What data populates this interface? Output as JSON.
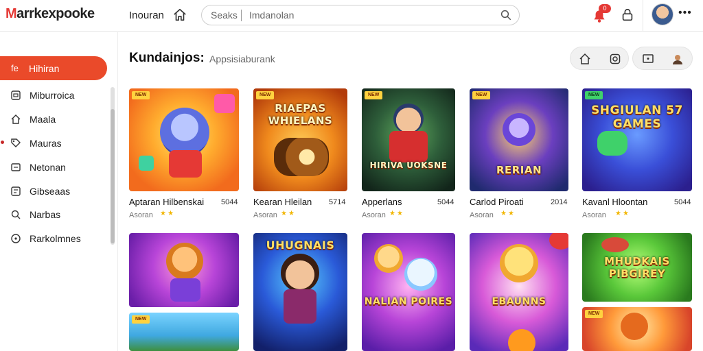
{
  "app": {
    "logo_initial": "M",
    "logo_rest": "arrkexpooke",
    "nav_label": "Inouran"
  },
  "search": {
    "label": "Seaks",
    "placeholder": "Imdanolan"
  },
  "notifications": {
    "badge": "0"
  },
  "sidebar": {
    "active": {
      "icon": "fe",
      "label": "Hihiran"
    },
    "items": [
      {
        "label": "Miburroica",
        "icon": "square-icon"
      },
      {
        "label": "Maala",
        "icon": "home-icon"
      },
      {
        "label": "Mauras",
        "icon": "tag-icon"
      },
      {
        "label": "Netonan",
        "icon": "tv-icon"
      },
      {
        "label": "Gibseaas",
        "icon": "gamepad-icon"
      },
      {
        "label": "Narbas",
        "icon": "search-icon"
      },
      {
        "label": "Rarkolmnes",
        "icon": "circle-icon"
      }
    ]
  },
  "main": {
    "title": "Kundainjos:",
    "subtitle": "Appsisiaburank"
  },
  "cards": [
    {
      "name": "Aptaran Hilbenskai",
      "num": "5044",
      "sub": "Asoran",
      "stars": "★★",
      "art_title": "",
      "tag": "NEW"
    },
    {
      "name": "Kearan Hleilan",
      "num": "5714",
      "sub": "Asoran",
      "stars": "★★",
      "art_title": "RIAEPAS WHIELANS",
      "tag": "NEW"
    },
    {
      "name": "Apperlans",
      "num": "5044",
      "sub": "Asoran",
      "stars": "★★",
      "art_title": "HIRIVA UOKSNE",
      "tag": "NEW"
    },
    {
      "name": "Carlod Piroati",
      "num": "2014",
      "sub": "Asoran",
      "stars": "★★",
      "art_title": "RERIAN",
      "tag": "NEW"
    },
    {
      "name": "Kavanl Hloontan",
      "num": "5044",
      "sub": "Asoran",
      "stars": "★★",
      "art_title": "SHGIULAN 57 GAMES",
      "tag": "NEW"
    },
    {
      "name": "",
      "num": "",
      "sub": "",
      "stars": "",
      "art_title": "",
      "tag": ""
    },
    {
      "name": "",
      "num": "",
      "sub": "",
      "stars": "",
      "art_title": "UHUGNAIS",
      "tag": ""
    },
    {
      "name": "",
      "num": "",
      "sub": "",
      "stars": "",
      "art_title": "NALIAN POIRES",
      "tag": ""
    },
    {
      "name": "",
      "num": "",
      "sub": "",
      "stars": "",
      "art_title": "EBAUNNS",
      "tag": ""
    },
    {
      "name": "",
      "num": "",
      "sub": "",
      "stars": "",
      "art_title": "MHUDKAIS PIBGIREY",
      "tag": ""
    }
  ],
  "colors": {
    "accent": "#ea4a2a",
    "badge": "#e53935",
    "star": "#f2b600"
  }
}
